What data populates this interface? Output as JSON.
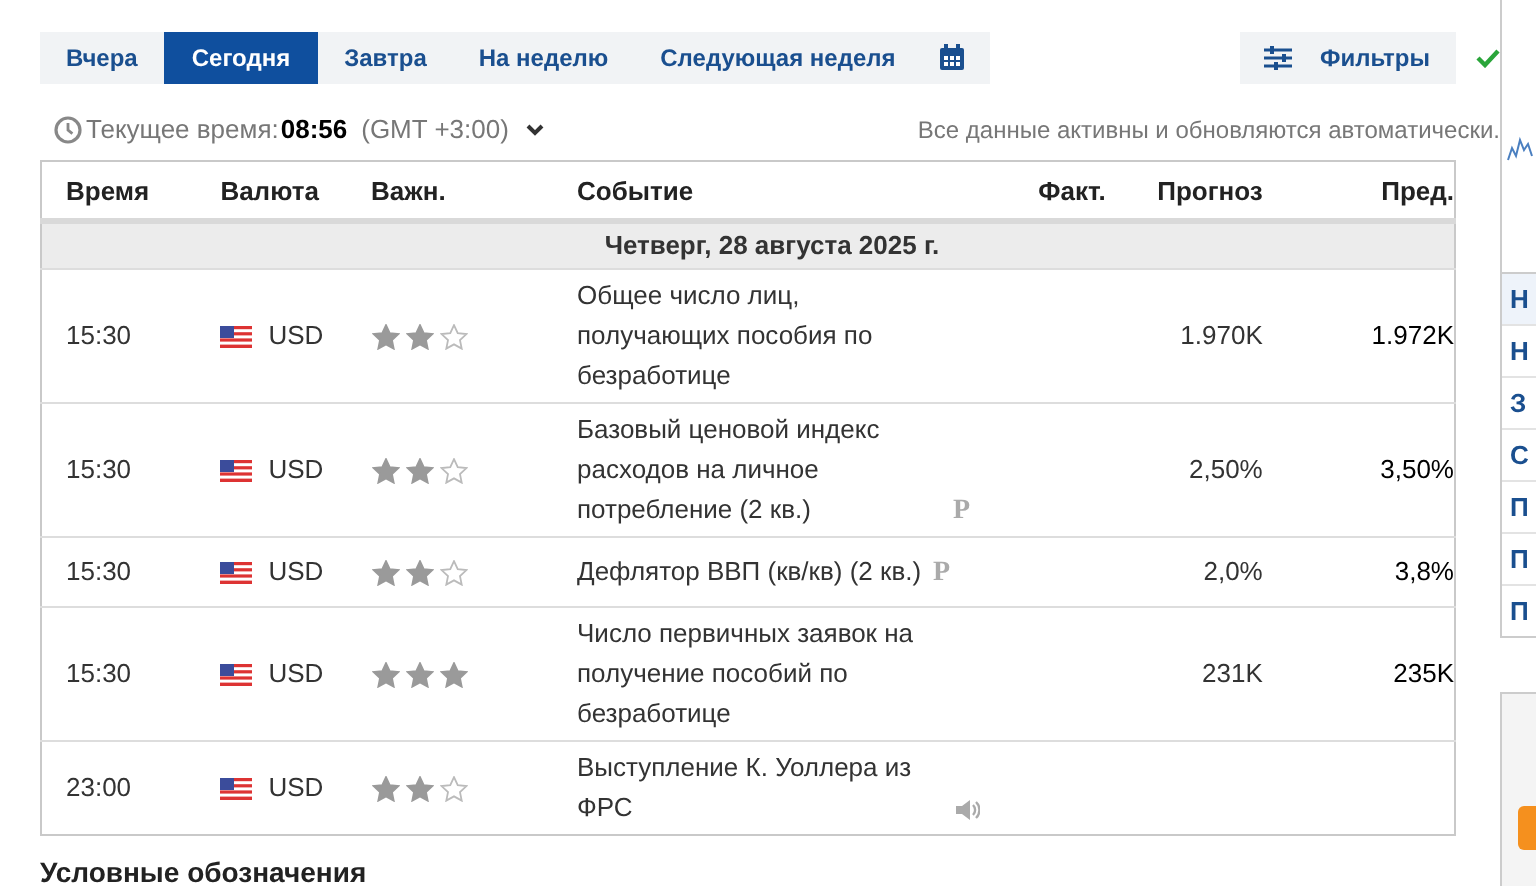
{
  "tabs": [
    {
      "label": "Вчера",
      "selected": false
    },
    {
      "label": "Сегодня",
      "selected": true
    },
    {
      "label": "Завтра",
      "selected": false
    },
    {
      "label": "На неделю",
      "selected": false
    },
    {
      "label": "Следующая неделя",
      "selected": false
    }
  ],
  "filters": {
    "label": "Фильтры",
    "applied": true
  },
  "time_bar": {
    "label": "Текущее время:",
    "time": "08:56",
    "timezone": "(GMT +3:00)",
    "notice": "Все данные активны и обновляются автоматически."
  },
  "table": {
    "columns": [
      "Время",
      "Валюта",
      "Важн.",
      "Событие",
      "Факт.",
      "Прогноз",
      "Пред."
    ],
    "date": "Четверг, 28 августа 2025 г.",
    "rows": [
      {
        "time": "15:30",
        "currency": "USD",
        "stars": 2,
        "event": "Общее число лиц, получающих пособия по безработице",
        "badge": "",
        "audio": false,
        "actual": "",
        "forecast": "1.970K",
        "previous": "1.972K"
      },
      {
        "time": "15:30",
        "currency": "USD",
        "stars": 2,
        "event": "Базовый ценовой индекс расходов на личное потребление (2 кв.)",
        "badge": "P",
        "audio": false,
        "actual": "",
        "forecast": "2,50%",
        "previous": "3,50%"
      },
      {
        "time": "15:30",
        "currency": "USD",
        "stars": 2,
        "event": "Дефлятор ВВП (кв/кв) (2 кв.)",
        "badge": "P",
        "audio": false,
        "actual": "",
        "forecast": "2,0%",
        "previous": "3,8%"
      },
      {
        "time": "15:30",
        "currency": "USD",
        "stars": 3,
        "event": "Число первичных заявок на получение пособий по безработице",
        "badge": "",
        "audio": false,
        "actual": "",
        "forecast": "231K",
        "previous": "235K"
      },
      {
        "time": "23:00",
        "currency": "USD",
        "stars": 2,
        "event": "Выступление К. Уоллера из ФРС",
        "badge": "",
        "audio": true,
        "actual": "",
        "forecast": "",
        "previous": ""
      }
    ]
  },
  "legend": {
    "title": "Условные обозначения"
  },
  "sidebar": {
    "items": [
      "Н",
      "Н",
      "З",
      "С",
      "П",
      "П",
      "П"
    ]
  }
}
